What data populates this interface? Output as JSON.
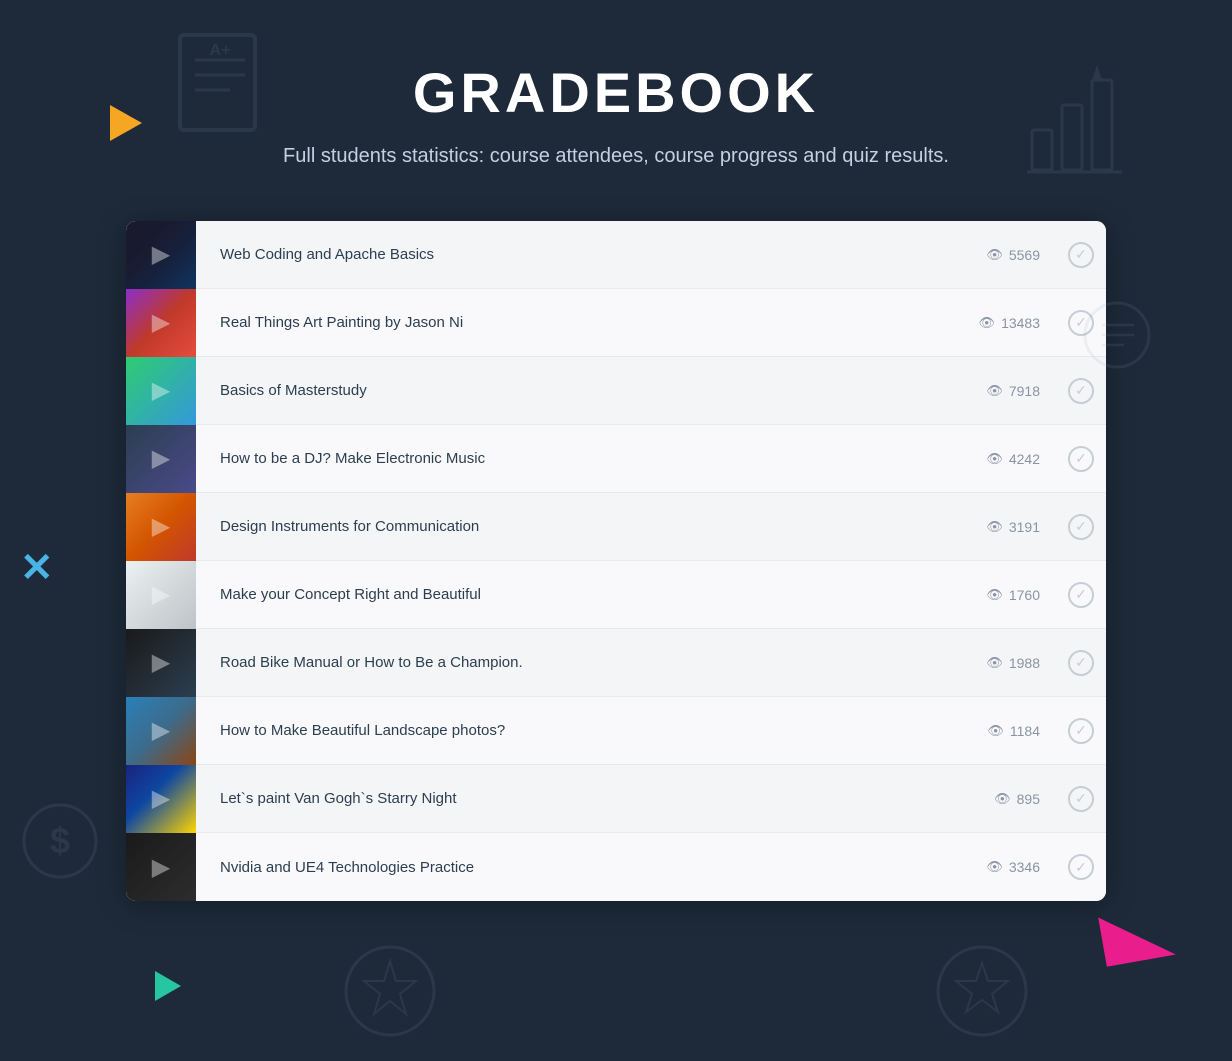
{
  "header": {
    "title": "GRADEBOOK",
    "subtitle": "Full students statistics: course attendees, course progress and quiz results."
  },
  "courses": [
    {
      "id": 1,
      "name": "Web Coding and Apache Basics",
      "views": 5569,
      "thumb_class": "thumb-coding"
    },
    {
      "id": 2,
      "name": "Real Things Art Painting by Jason Ni",
      "views": 13483,
      "thumb_class": "thumb-art"
    },
    {
      "id": 3,
      "name": "Basics of Masterstudy",
      "views": 7918,
      "thumb_class": "thumb-masterstudy"
    },
    {
      "id": 4,
      "name": "How to be a DJ? Make Electronic Music",
      "views": 4242,
      "thumb_class": "thumb-dj"
    },
    {
      "id": 5,
      "name": "Design Instruments for Communication",
      "views": 3191,
      "thumb_class": "thumb-design"
    },
    {
      "id": 6,
      "name": "Make your Concept Right and Beautiful",
      "views": 1760,
      "thumb_class": "thumb-concept"
    },
    {
      "id": 7,
      "name": "Road Bike Manual or How to Be a Champion.",
      "views": 1988,
      "thumb_class": "thumb-bike"
    },
    {
      "id": 8,
      "name": "How to Make Beautiful Landscape photos?",
      "views": 1184,
      "thumb_class": "thumb-landscape"
    },
    {
      "id": 9,
      "name": "Let`s paint Van Gogh`s Starry Night",
      "views": 895,
      "thumb_class": "thumb-vangogh"
    },
    {
      "id": 10,
      "name": "Nvidia and UE4 Technologies Practice",
      "views": 3346,
      "thumb_class": "thumb-nvidia"
    }
  ]
}
